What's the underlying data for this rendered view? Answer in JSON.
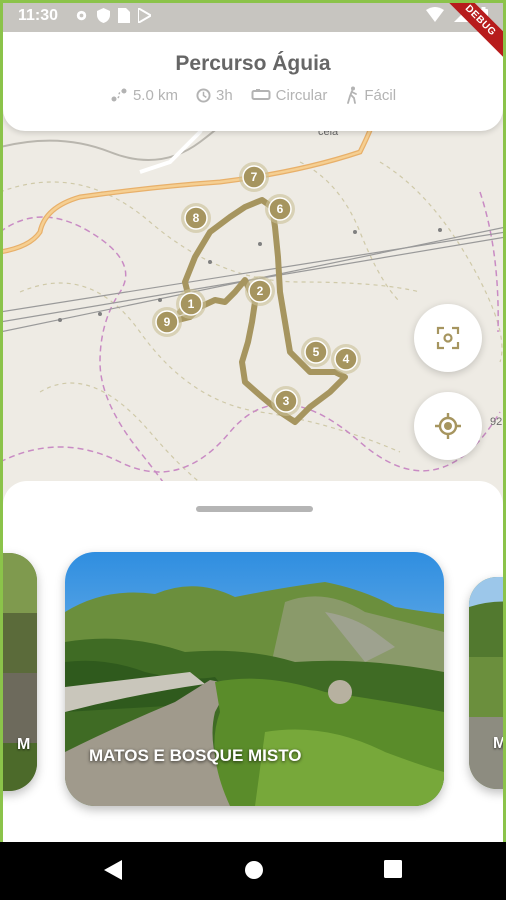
{
  "status_bar": {
    "time": "11:30",
    "debug_label": "DEBUG"
  },
  "header": {
    "title": "Percurso Águia",
    "stats": [
      {
        "icon": "distance-icon",
        "label": "5.0 km"
      },
      {
        "icon": "clock-icon",
        "label": "3h"
      },
      {
        "icon": "circular-route-icon",
        "label": "Circular"
      },
      {
        "icon": "hiker-icon",
        "label": "Fácil"
      }
    ]
  },
  "map": {
    "markers": [
      "1",
      "2",
      "3",
      "4",
      "5",
      "6",
      "7",
      "8",
      "9"
    ],
    "labels": {
      "top": "cela",
      "right": "92"
    },
    "route_color": "#a6955f"
  },
  "cards": {
    "main_title": "MATOS E BOSQUE MISTO",
    "left_letter": "M",
    "right_letter": "M"
  },
  "colors": {
    "frame": "#8bc34a",
    "accent": "#a6955f",
    "status_bar": "#c7c5c0"
  }
}
